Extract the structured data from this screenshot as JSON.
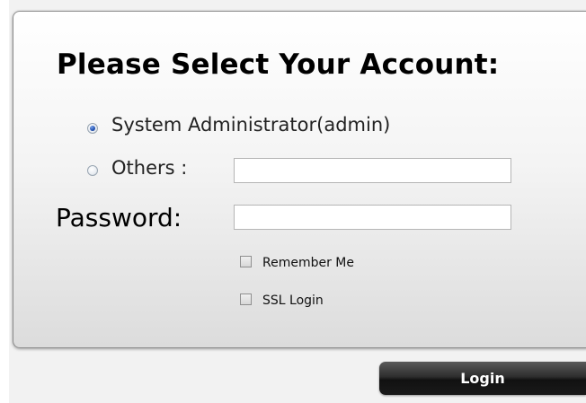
{
  "login_form": {
    "title": "Please Select Your Account:",
    "account_options": [
      {
        "label": "System Administrator(admin)",
        "selected": true
      },
      {
        "label": "Others :",
        "selected": false
      }
    ],
    "others_input_value": "",
    "password_label": "Password:",
    "password_value": "",
    "remember_me": {
      "label": "Remember Me",
      "checked": false
    },
    "ssl_login": {
      "label": "SSL Login",
      "checked": false
    },
    "login_button_label": "Login"
  },
  "colors": {
    "panel_border": "#8c8c8c",
    "radio_selected": "#1f4fb0",
    "button_dark": "#1a1a1a",
    "button_text": "#ffffff"
  }
}
